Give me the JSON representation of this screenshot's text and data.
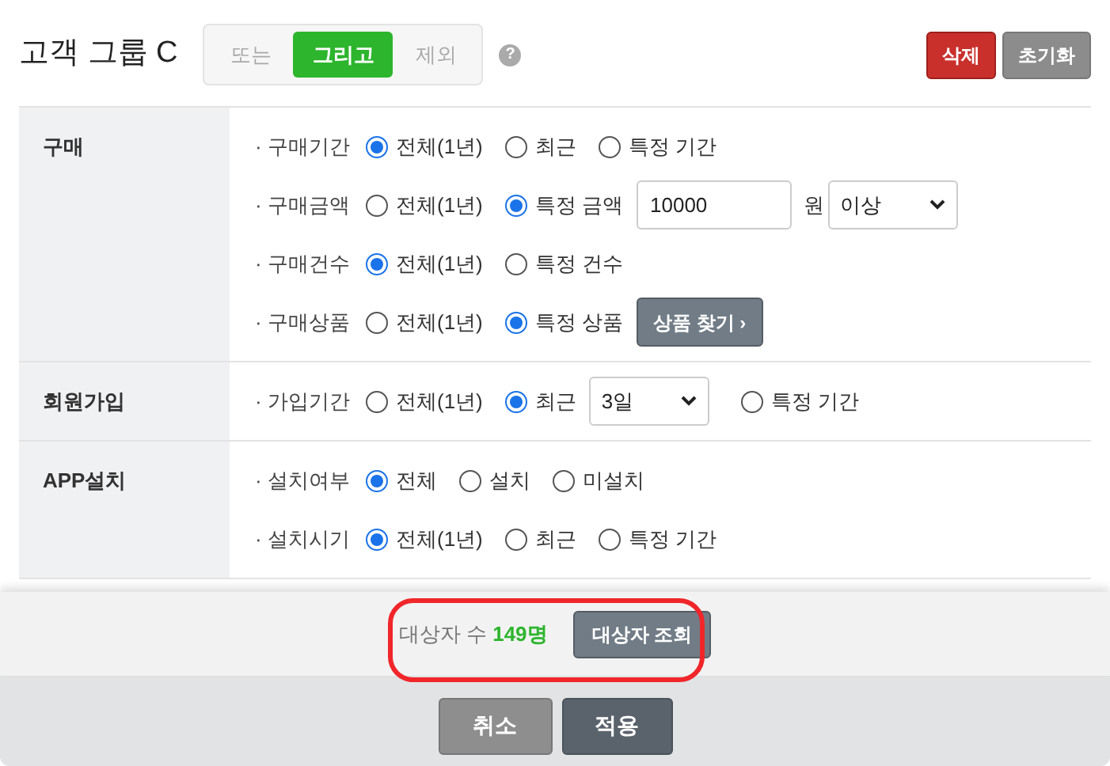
{
  "header": {
    "title": "고객 그룹 C",
    "modes": [
      {
        "label": "또는",
        "selected": false
      },
      {
        "label": "그리고",
        "selected": true
      },
      {
        "label": "제외",
        "selected": false
      }
    ],
    "help": "?",
    "buttons": [
      {
        "label": "삭제",
        "kind": "danger"
      },
      {
        "label": "초기화",
        "kind": "neutral"
      }
    ]
  },
  "sections": [
    {
      "label": "구매",
      "rows": [
        {
          "label": "· 구매기간",
          "items": [
            {
              "kind": "radio",
              "label": "전체(1년)",
              "selected": true
            },
            {
              "kind": "radio",
              "label": "최근",
              "selected": false
            },
            {
              "kind": "radio",
              "label": "특정 기간",
              "selected": false
            }
          ]
        },
        {
          "label": "· 구매금액",
          "items": [
            {
              "kind": "radio",
              "label": "전체(1년)",
              "selected": false
            },
            {
              "kind": "radio",
              "label": "특정 금액",
              "selected": true
            },
            {
              "kind": "input",
              "value": "10000"
            },
            {
              "kind": "text",
              "label": "원"
            },
            {
              "kind": "select",
              "value": "이상"
            }
          ]
        },
        {
          "label": "· 구매건수",
          "items": [
            {
              "kind": "radio",
              "label": "전체(1년)",
              "selected": true
            },
            {
              "kind": "radio",
              "label": "특정 건수",
              "selected": false
            }
          ]
        },
        {
          "label": "· 구매상품",
          "items": [
            {
              "kind": "radio",
              "label": "전체(1년)",
              "selected": false
            },
            {
              "kind": "radio",
              "label": "특정 상품",
              "selected": true
            },
            {
              "kind": "button",
              "label": "상품 찾기 ›"
            }
          ]
        }
      ]
    },
    {
      "label": "회원가입",
      "rows": [
        {
          "label": "· 가입기간",
          "items": [
            {
              "kind": "radio",
              "label": "전체(1년)",
              "selected": false
            },
            {
              "kind": "radio",
              "label": "최근",
              "selected": true
            },
            {
              "kind": "select",
              "value": "3일"
            },
            {
              "kind": "radio",
              "label": "특정 기간",
              "selected": false
            }
          ]
        }
      ]
    },
    {
      "label": "APP설치",
      "rows": [
        {
          "label": "· 설치여부",
          "items": [
            {
              "kind": "radio",
              "label": "전체",
              "selected": true
            },
            {
              "kind": "radio",
              "label": "설치",
              "selected": false
            },
            {
              "kind": "radio",
              "label": "미설치",
              "selected": false
            }
          ]
        },
        {
          "label": "· 설치시기",
          "items": [
            {
              "kind": "radio",
              "label": "전체(1년)",
              "selected": true
            },
            {
              "kind": "radio",
              "label": "최근",
              "selected": false
            },
            {
              "kind": "radio",
              "label": "특정 기간",
              "selected": false
            }
          ]
        }
      ]
    }
  ],
  "summary": {
    "label": "대상자 수",
    "count": "149명",
    "button": "대상자 조회"
  },
  "footer": {
    "buttons": [
      {
        "label": "취소",
        "kind": "cancel"
      },
      {
        "label": "적용",
        "kind": "apply"
      }
    ]
  }
}
